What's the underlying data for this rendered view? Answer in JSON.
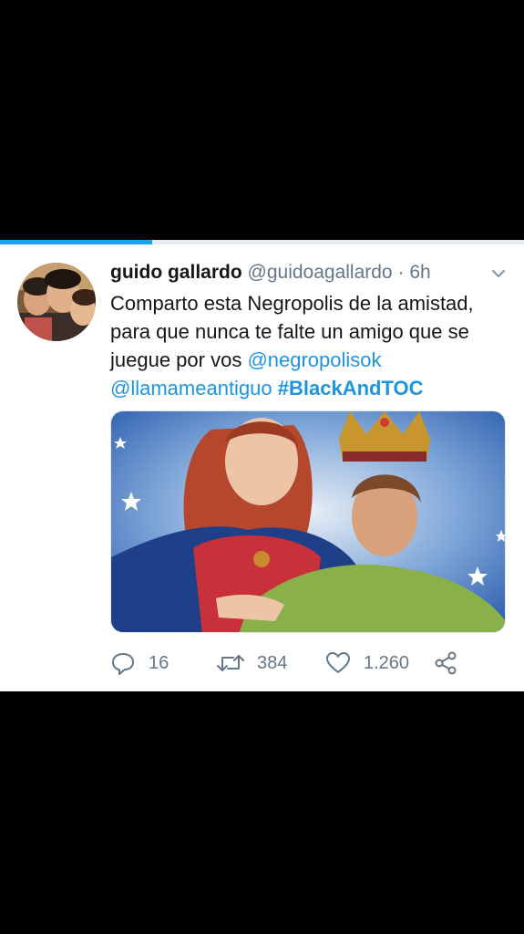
{
  "progress": {
    "percent": 29,
    "color": "#1da1f2"
  },
  "tweet": {
    "display_name": "guido gallardo",
    "handle": "@guidoagallardo",
    "separator": "·",
    "time": "6h",
    "text": {
      "plain": "Comparto esta Negropolis de la amistad, para que nunca te falte un amigo que se juegue por vos ",
      "mention_1": "@negropolisok",
      "mention_2": "@llamameantiguo",
      "hashtag": "#BlackAndTOC"
    },
    "avatar_icon": "profile-photo",
    "media_icon": "attached-image"
  },
  "actions": {
    "reply_count": "16",
    "retweet_count": "384",
    "like_count": "1.260"
  },
  "colors": {
    "accent": "#1da1f2",
    "link": "#1b95e0",
    "secondary_text": "#657786",
    "primary_text": "#14171a"
  }
}
